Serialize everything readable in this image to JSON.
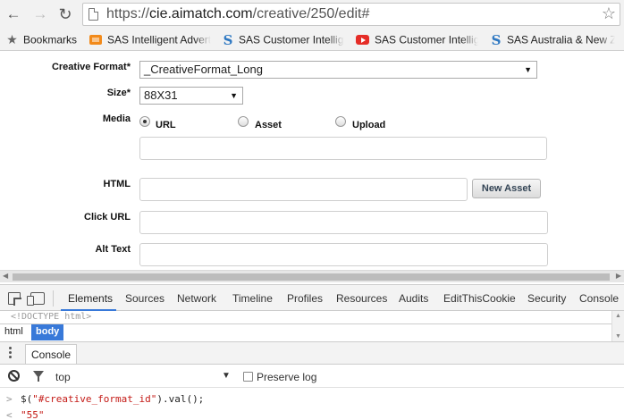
{
  "browser": {
    "url_scheme": "https://",
    "url_host": "cie.aimatch.com",
    "url_path": "/creative/250/edit#",
    "back_glyph": "←",
    "forward_glyph": "→",
    "reload_glyph": "C",
    "star_glyph": "☆"
  },
  "bookmarks_bar": {
    "items": [
      {
        "label": "Bookmarks",
        "icon": "star-icon"
      },
      {
        "label": "SAS Intelligent Advert",
        "icon": "sas-orange-icon"
      },
      {
        "label": "SAS Customer Intellig",
        "icon": "sas-s-icon"
      },
      {
        "label": "SAS Customer Intellig",
        "icon": "youtube-icon"
      },
      {
        "label": "SAS Australia & New Z",
        "icon": "sas-s-icon"
      }
    ]
  },
  "form": {
    "creative_format_label": "Creative Format*",
    "creative_format_value": "_CreativeFormat_Long",
    "size_label": "Size*",
    "size_value": "88X31",
    "media_label": "Media",
    "media_options": [
      "URL",
      "Asset",
      "Upload"
    ],
    "media_selected": "URL",
    "html_label": "HTML",
    "new_asset_button": "New Asset",
    "click_url_label": "Click URL",
    "alt_text_label": "Alt Text",
    "dropdown_arrow": "▼"
  },
  "devtools": {
    "tabs": [
      "Elements",
      "Sources",
      "Network",
      "Timeline",
      "Profiles",
      "Resources",
      "Audits",
      "EditThisCookie",
      "Security",
      "Console"
    ],
    "active_tab": "Elements",
    "more_glyph": "»",
    "doctype_text": "<!DOCTYPE html>",
    "breadcrumbs": [
      "html",
      "body"
    ],
    "selected_breadcrumb": "body",
    "drawer_tab": "Console",
    "context": "top",
    "context_arrow": "▼",
    "preserve_log_label": "Preserve log",
    "preserve_log_checked": false,
    "console_lines": [
      {
        "prefix": ">",
        "fn": "$(",
        "arg": "\"#creative_format_id\"",
        "rest": ").val();"
      },
      {
        "prefix": "<",
        "result": "\"55\""
      }
    ]
  },
  "colors": {
    "accent": "#3879d9",
    "chrome_bg": "#f2f2f2",
    "string_red": "#c41a16"
  }
}
